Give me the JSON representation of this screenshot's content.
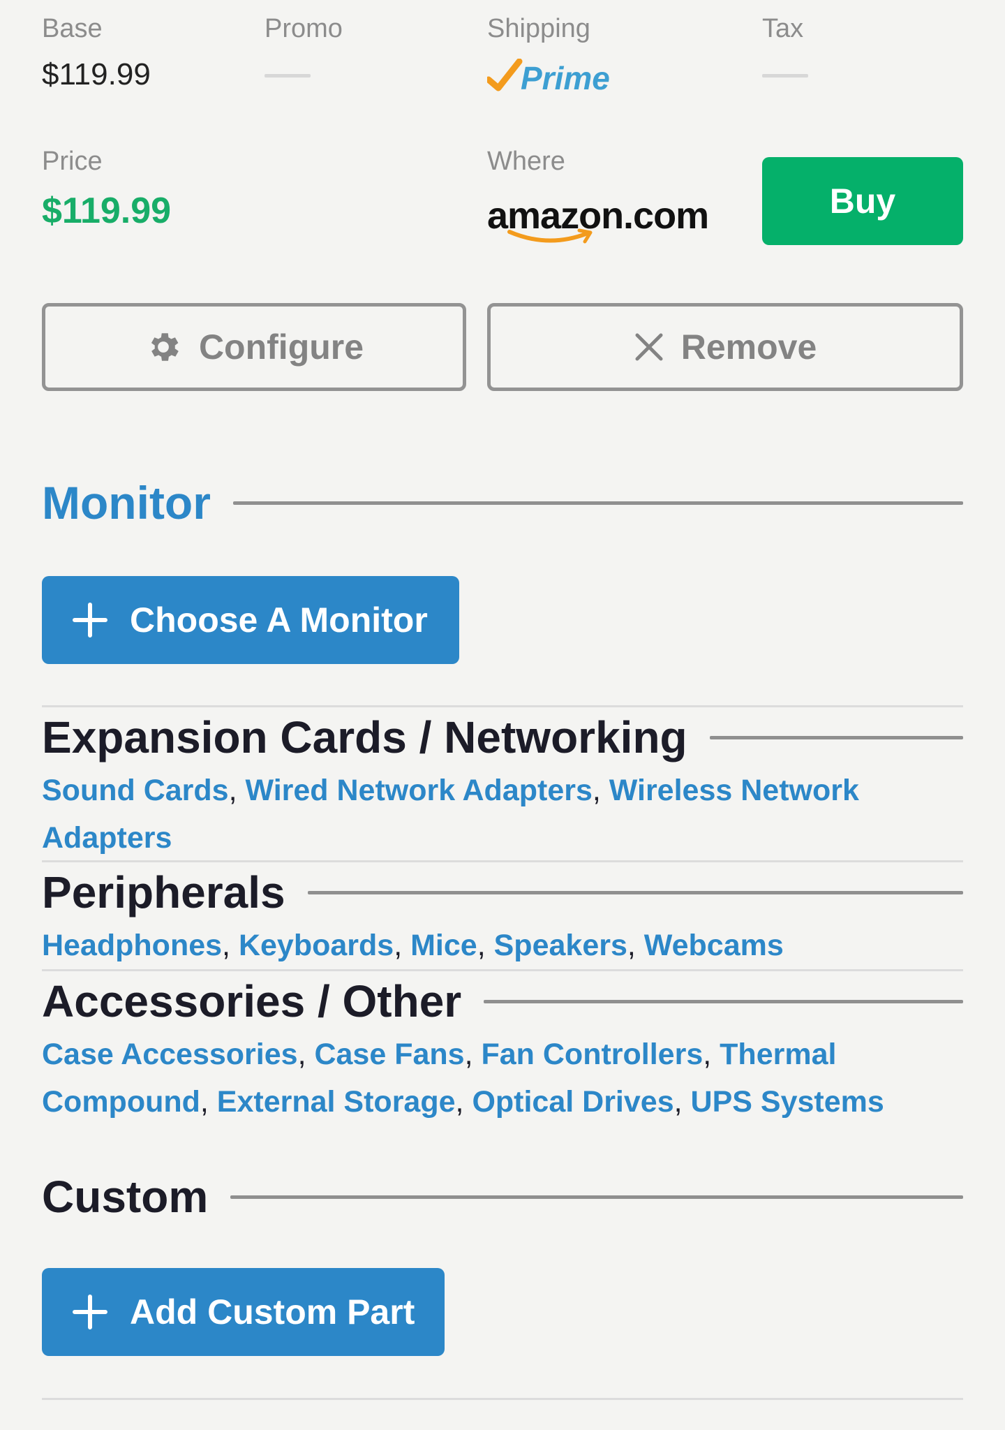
{
  "summary": {
    "base_label": "Base",
    "base_value": "$119.99",
    "promo_label": "Promo",
    "shipping_label": "Shipping",
    "shipping_logo_text": "Prime",
    "tax_label": "Tax",
    "price_label": "Price",
    "price_value": "$119.99",
    "where_label": "Where",
    "where_logo_text": "amazon.com",
    "buy_label": "Buy"
  },
  "actions": {
    "configure_label": "Configure",
    "remove_label": "Remove"
  },
  "monitor": {
    "title": "Monitor",
    "choose_label": "Choose A Monitor"
  },
  "categories": [
    {
      "title": "Expansion Cards / Networking",
      "links": [
        "Sound Cards",
        "Wired Network Adapters",
        "Wireless Network Adapters"
      ]
    },
    {
      "title": "Peripherals",
      "links": [
        "Headphones",
        "Keyboards",
        "Mice",
        "Speakers",
        "Webcams"
      ]
    },
    {
      "title": "Accessories / Other",
      "links": [
        "Case Accessories",
        "Case Fans",
        "Fan Controllers",
        "Thermal Compound",
        "External Storage",
        "Optical Drives",
        "UPS Systems"
      ]
    }
  ],
  "custom": {
    "title": "Custom",
    "add_label": "Add Custom Part"
  },
  "colors": {
    "accent_blue": "#2c87c8",
    "price_green": "#18ad68",
    "buy_green": "#05b06a"
  }
}
